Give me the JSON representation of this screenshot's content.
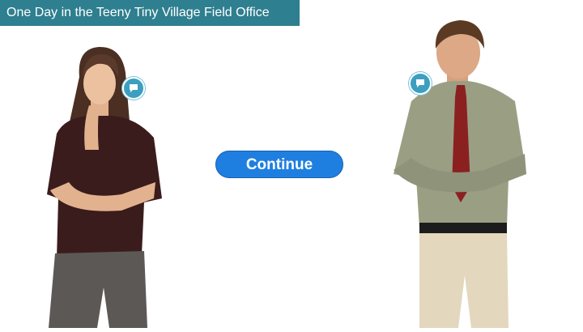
{
  "header": {
    "title": "One Day in the Teeny Tiny Village Field Office",
    "bar_color": "#2e7f8f"
  },
  "characters": [
    {
      "name_icon": "woman-figure",
      "callout": "speech-bubble-icon"
    },
    {
      "name_icon": "man-figure",
      "callout": "speech-bubble-icon"
    }
  ],
  "main": {
    "continue_label": "Continue",
    "accent": "#1e7fe0"
  }
}
